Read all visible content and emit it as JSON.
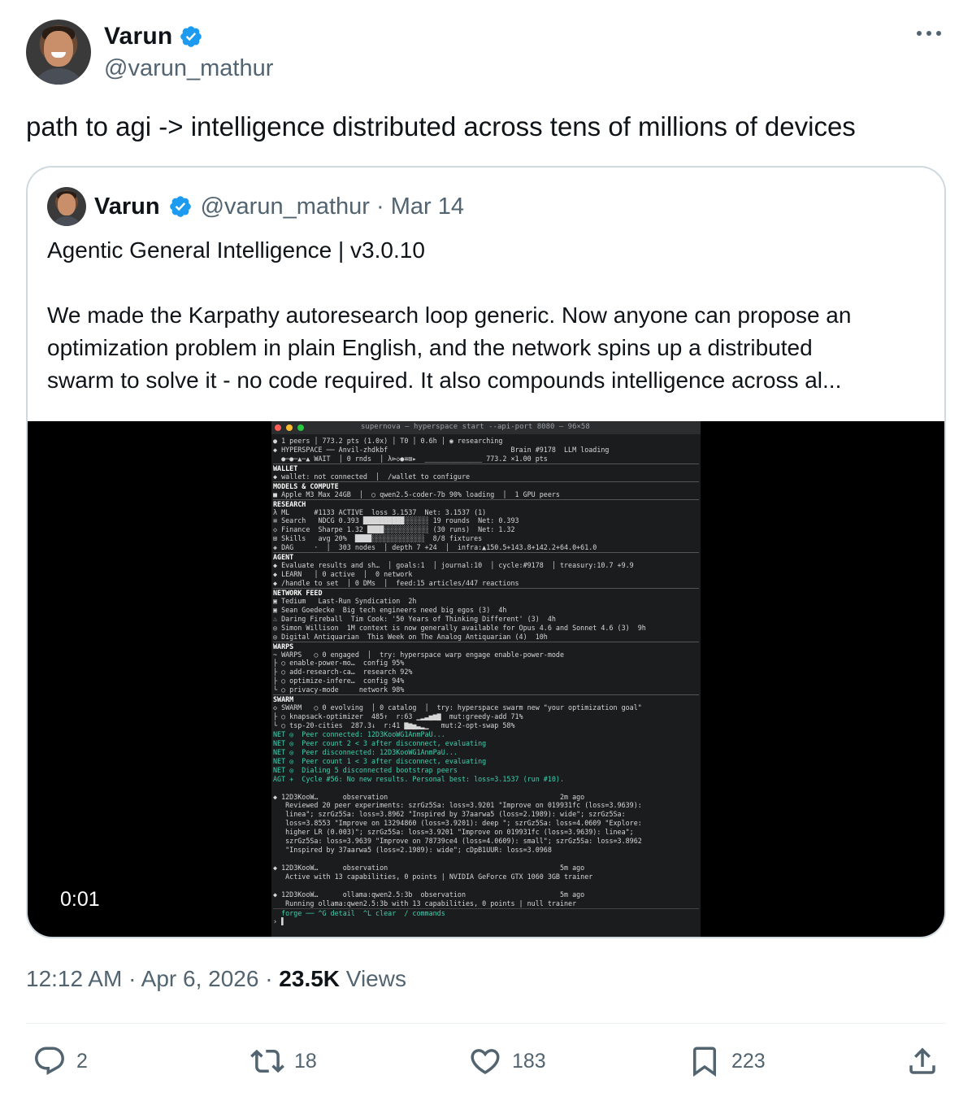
{
  "author": {
    "name": "Varun",
    "handle": "@varun_mathur",
    "verified_color": "#1d9bf0"
  },
  "tweet": {
    "text": "path to agi -> intelligence distributed across tens of millions of devices",
    "timestamp": "12:12 AM · Apr 6, 2026 · ",
    "views_count": "23.5K",
    "views_label": " Views"
  },
  "quote": {
    "name": "Varun",
    "handle_date": "@varun_mathur · Mar 14",
    "title": "Agentic General Intelligence | v3.0.10",
    "body_lines": [
      "We made the Karpathy autoresearch loop generic. Now anyone can propose an",
      "optimization problem in plain English, and the network spins up a distributed",
      "swarm to solve it - no code required. It also compounds intelligence across al..."
    ],
    "video_time": "0:01"
  },
  "terminal": {
    "title": "supernova — hyperspace start --api-port 8080 — 96×58",
    "lines": [
      "● 1 peers │ 773.2 pts (1.0x) │ T0 │ 0.6h │ ◉ researching",
      "◆ HYPERSPACE ── Anvil-zhdkbf                              Brain #9178  LLM loading",
      "  ●─●─▲─▲ WAIT  │ 0 rnds  │ λ⊳◇●≡⊞▸  ______________ 773.2 ×1.00 pts",
      "WALLET",
      "◆ wallet: not connected  │  /wallet to configure",
      "MODELS & COMPUTE",
      "■ Apple M3 Max 24GB  │  ○ qwen2.5-coder-7b 90% loading  │  1 GPU peers",
      "RESEARCH",
      "λ ML      #1133 ACTIVE  loss 3.1537  Net: 3.1537 (1)",
      "≡ Search   NDCG 0.393 ██████████░░░░░░ 19 rounds  Net: 0.393",
      "◇ Finance  Sharpe 1.32 ████░░░░░░░░░░░ (30 runs)  Net: 1.32",
      "⊞ Skills   avg 20%  ████░░░░░░░░░░░░░  8/8 fixtures",
      "◈ DAG     ·  │  303 nodes  │ depth 7 +24  │  infra:▲150.5+143.8+142.2+64.0+61.0",
      "AGENT",
      "◆ Evaluate results and sh…  │ goals:1  │ journal:10  │ cycle:#9178  │ treasury:10.7 +9.9",
      "◆ LEARN   │ 0 active  │  0 network",
      "◆ /handle to set  │ 0 DMs  │  feed:15 articles/447 reactions",
      "NETWORK FEED",
      "▣ Tedium   Last-Run Syndication  2h",
      "▣ Sean Goedecke  Big tech engineers need big egos (3)  4h",
      "♨ Daring Fireball  Tim Cook: '50 Years of Thinking Different' (3)  4h",
      "◎ Simon Willison  1M context is now generally available for Opus 4.6 and Sonnet 4.6 (3)  9h",
      "◎ Digital Antiquarian  This Week on The Analog Antiquarian (4)  10h",
      "WARPS",
      "~ WARPS   ○ 0 engaged  │  try: hyperspace warp engage enable-power-mode",
      "├ ○ enable-power-mo…  config 95%",
      "├ ○ add-research-ca…  research 92%",
      "├ ○ optimize-infere…  config 94%",
      "└ ○ privacy-mode     network 98%",
      "SWARM",
      "◇ SWARM   ○ 0 evolving  │ 0 catalog  │  try: hyperspace swarm new \"your optimization goal\"",
      "├ ○ knapsack-optimizer  485↑  r:63 ▁▂▃▅▆▇  mut:greedy-add 71%",
      "└ ○ tsp-20-cities  287.3↓  r:41 ▇▆▅▃▂▁   mut:2-opt-swap 58%",
      "NET ◎  Peer connected: 12D3KooWG1AnmPaU...",
      "NET ◎  Peer count 2 < 3 after disconnect, evaluating",
      "NET ◎  Peer disconnected: 12D3KooWG1AnmPaU...",
      "NET ◎  Peer count 1 < 3 after disconnect, evaluating",
      "NET ◎  Dialing 5 disconnected bootstrap peers",
      "AGT ✈  Cycle #56: No new results. Personal best: loss=3.1537 (run #10).",
      "",
      "◆ 12D3KooW…      observation                                          2m ago",
      "   Reviewed 20 peer experiments: szrGz5Sa: loss=3.9201 \"Improve on 019931fc (loss=3.9639):",
      "   linea\"; szrGz5Sa: loss=3.8962 \"Inspired by 37aarwa5 (loss=2.1989): wide\"; szrGz5Sa:",
      "   loss=3.8553 \"Improve on 13294860 (loss=3.9201): deep \"; szrGz5Sa: loss=4.0609 \"Explore:",
      "   higher LR (0.003)\"; szrGz5Sa: loss=3.9201 \"Improve on 019931fc (loss=3.9639): linea\";",
      "   szrGz5Sa: loss=3.9639 \"Improve on 78739ce4 (loss=4.0609): small\"; szrGz5Sa: loss=3.8962",
      "   \"Inspired by 37aarwa5 (loss=2.1989): wide\"; cDpB1UUR: loss=3.0968",
      "",
      "◆ 12D3KooW…      observation                                          5m ago",
      "   Active with 13 capabilities, 0 points | NVIDIA GeForce GTX 1060 3GB trainer",
      "",
      "◆ 12D3KooW…      ollama:qwen2.5:3b  observation                       5m ago",
      "   Running ollama:qwen2.5:3b with 13 capabilities, 0 points | null trainer",
      "  forge ── ^G detail  ^L clear  / commands",
      "› ▌"
    ]
  },
  "actions": {
    "replies": "2",
    "reposts": "18",
    "likes": "183",
    "bookmarks": "223"
  }
}
